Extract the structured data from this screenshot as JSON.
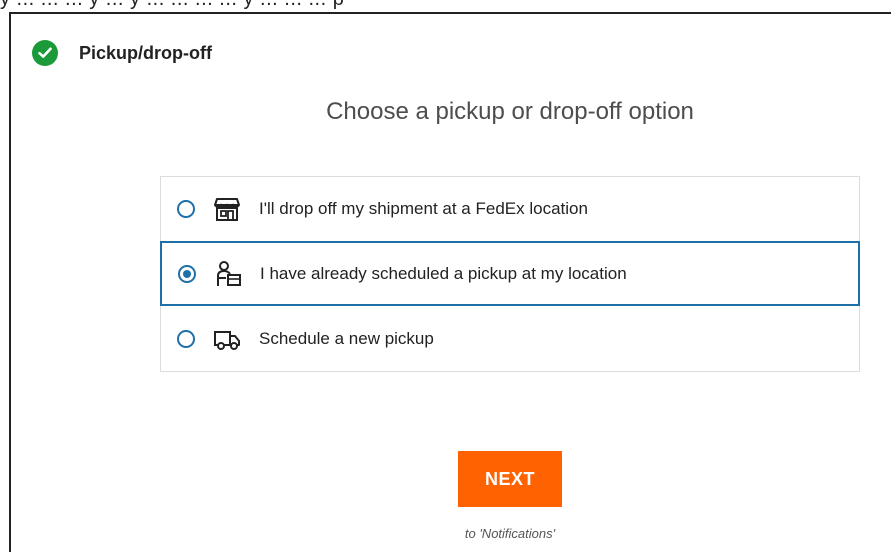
{
  "top_strip_text": "y ... ... ... y ... y ... ... ... ... y ... ... ... p",
  "section": {
    "title": "Pickup/drop-off",
    "status": "complete",
    "status_color": "#1a9a38"
  },
  "heading": "Choose a pickup or drop-off option",
  "options": [
    {
      "label": "I'll drop off my shipment at a FedEx location",
      "icon": "store-icon",
      "selected": false
    },
    {
      "label": "I have already scheduled a pickup at my location",
      "icon": "courier-package-icon",
      "selected": true
    },
    {
      "label": "Schedule a new pickup",
      "icon": "truck-icon",
      "selected": false
    }
  ],
  "next_button": {
    "label": "NEXT",
    "color": "#ff6200"
  },
  "next_hint": "to 'Notifications'",
  "colors": {
    "accent": "#1f6fa8",
    "border": "#dcdcdc",
    "text": "#222222"
  }
}
